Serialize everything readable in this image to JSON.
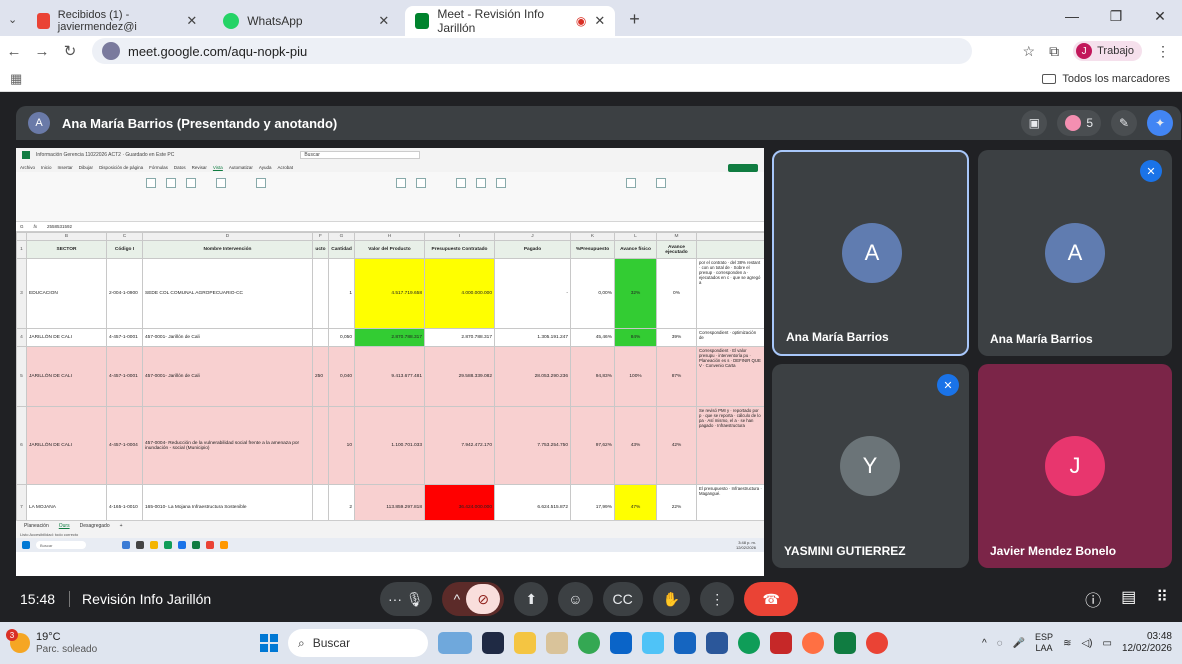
{
  "browser": {
    "tabs": [
      {
        "label": "Recibidos (1) - javiermendez@i",
        "icon_color": "#ea4335",
        "active": false
      },
      {
        "label": "WhatsApp",
        "icon_color": "#25d366",
        "active": false
      },
      {
        "label": "Meet - Revisión Info Jarillón",
        "icon_color": "#00832d",
        "active": true
      }
    ],
    "url": "meet.google.com/aqu-nopk-piu",
    "profile_initial": "J",
    "profile_label": "Trabajo",
    "all_bookmarks": "Todos los marcadores"
  },
  "presenter": {
    "initial": "A",
    "label": "Ana María Barrios (Presentando y anotando)",
    "people_count": "5"
  },
  "excel": {
    "title": "Información Gerencia 11022026 ACT2 · Guardado en Este PC",
    "search": "Buscar",
    "menu": [
      "Archivo",
      "Inicio",
      "Insertar",
      "Dibujar",
      "Disposición de página",
      "Fórmulas",
      "Datos",
      "Revisar",
      "Vista",
      "Automatizar",
      "Ayuda",
      "Acrobat"
    ],
    "active_menu": "Vista",
    "cell_ref": "G",
    "formula": "2558531592",
    "columns": [
      "B",
      "C",
      "D",
      "F",
      "G",
      "H",
      "I",
      "J",
      "K",
      "L",
      "M",
      ""
    ],
    "headers": [
      "SECTOR",
      "Código I",
      "Nombre Intervención",
      "ucto",
      "Cantidad",
      "Valor del Producto",
      "Presupuesto Contratado",
      "Pagado",
      "%Presupuesto",
      "Avance físico",
      "Avance ejecutado",
      ""
    ],
    "rows": [
      {
        "num": "3",
        "sector": "EDUCACION",
        "code": "2-004-1-0900",
        "name": "SEDE COL COMUNAL AGROPECUARIO-CC",
        "u": "",
        "qty": "1",
        "valor": "4.517.719.658",
        "pres": "4.000.000.000",
        "pagado": "-",
        "pct": "0,00%",
        "fis": "32%",
        "ejec": "0%",
        "obs": "por el contrato · del 38% restant · con un total de · Sobre el presup · corresponden a · ejecutados en c · que se agregó a"
      },
      {
        "num": "4",
        "sector": "JARILLÓN DE CALI",
        "code": "4-457-1-0001",
        "name": "457-0001- Jarillón de Cali",
        "u": "",
        "qty": "0,050",
        "valor": "2.870.788.317",
        "pres": "2.870.788.317",
        "pagado": "1.305.191.247",
        "pct": "45,46%",
        "fis": "84%",
        "ejec": "39%",
        "obs": "Correspondient · optimización de"
      },
      {
        "num": "5",
        "sector": "JARILLÓN DE CALI",
        "code": "4-457-1-0001",
        "name": "457-0001- Jarillón de Cali",
        "u": "250",
        "qty": "0,040",
        "valor": "9.413.677.481",
        "pres": "29.588.339.082",
        "pagado": "28.053.290.236",
        "pct": "94,83%",
        "fis": "100%",
        "ejec": "87%",
        "obs": "Correspondient · El valor presupu · interventoría pu · Planeación es s · DEFINIR QUE V · Convenio Carta"
      },
      {
        "num": "6",
        "sector": "JARILLÓN DE CALI",
        "code": "4-457-1-0004",
        "name": "457-0004- Reducción de la vulnerabilidad social frente a la amenaza por inundación - social (Municipio)",
        "u": "",
        "qty": "10",
        "valor": "1.100.701.033",
        "pres": "7.942.472.170",
        "pagado": "7.753.254.750",
        "pct": "97,62%",
        "fis": "43%",
        "ejec": "42%",
        "obs": "Se revisó PMI y · reportado por p · que se reporta · cálculo de lo pa · Así mismo, el a · se han pagado · Infraestructura"
      },
      {
        "num": "7",
        "sector": "LA MOJANA",
        "code": "4-165-1-0010",
        "name": "165-0010- La Mojana Infraestructura Sostenible",
        "u": "",
        "qty": "2",
        "valor": "113.859.297.818",
        "pres": "36.424.000.000",
        "pagado": "6.624.515.872",
        "pct": "17,99%",
        "fis": "47%",
        "ejec": "22%",
        "obs": "El presupuesto · Infraestructura · Magangué."
      }
    ],
    "sheets": [
      "Planeación",
      "Ours",
      "Desagregado",
      "+"
    ],
    "active_sheet": "Ours",
    "status": "Listo   Accesibilidad: todo correcto",
    "mini_search": "Buscar",
    "mini_time": "3:48 p. m.",
    "mini_date": "12/02/2026"
  },
  "participants": [
    {
      "initial": "A",
      "name": "Ana María Barrios",
      "color": "#607cb0",
      "bg": "#3c4043",
      "muted": false,
      "active": true
    },
    {
      "initial": "A",
      "name": "Ana María Barrios",
      "color": "#607cb0",
      "bg": "#3c4043",
      "muted": true,
      "active": false
    },
    {
      "initial": "Y",
      "name": "YASMINI GUTIERREZ",
      "color": "#6b7478",
      "bg": "#3c4043",
      "muted": true,
      "active": false
    },
    {
      "initial": "J",
      "name": "Javier Mendez Bonelo",
      "color": "#e8366e",
      "bg": "#7b2548",
      "muted": false,
      "active": false
    }
  ],
  "meeting": {
    "time": "15:48",
    "title": "Revisión Info Jarillón"
  },
  "taskbar": {
    "temp": "19°C",
    "weather": "Parc. soleado",
    "weather_badge": "3",
    "search": "Buscar",
    "lang1": "ESP",
    "lang2": "LAA",
    "time": "03:48",
    "date": "12/02/2026"
  }
}
